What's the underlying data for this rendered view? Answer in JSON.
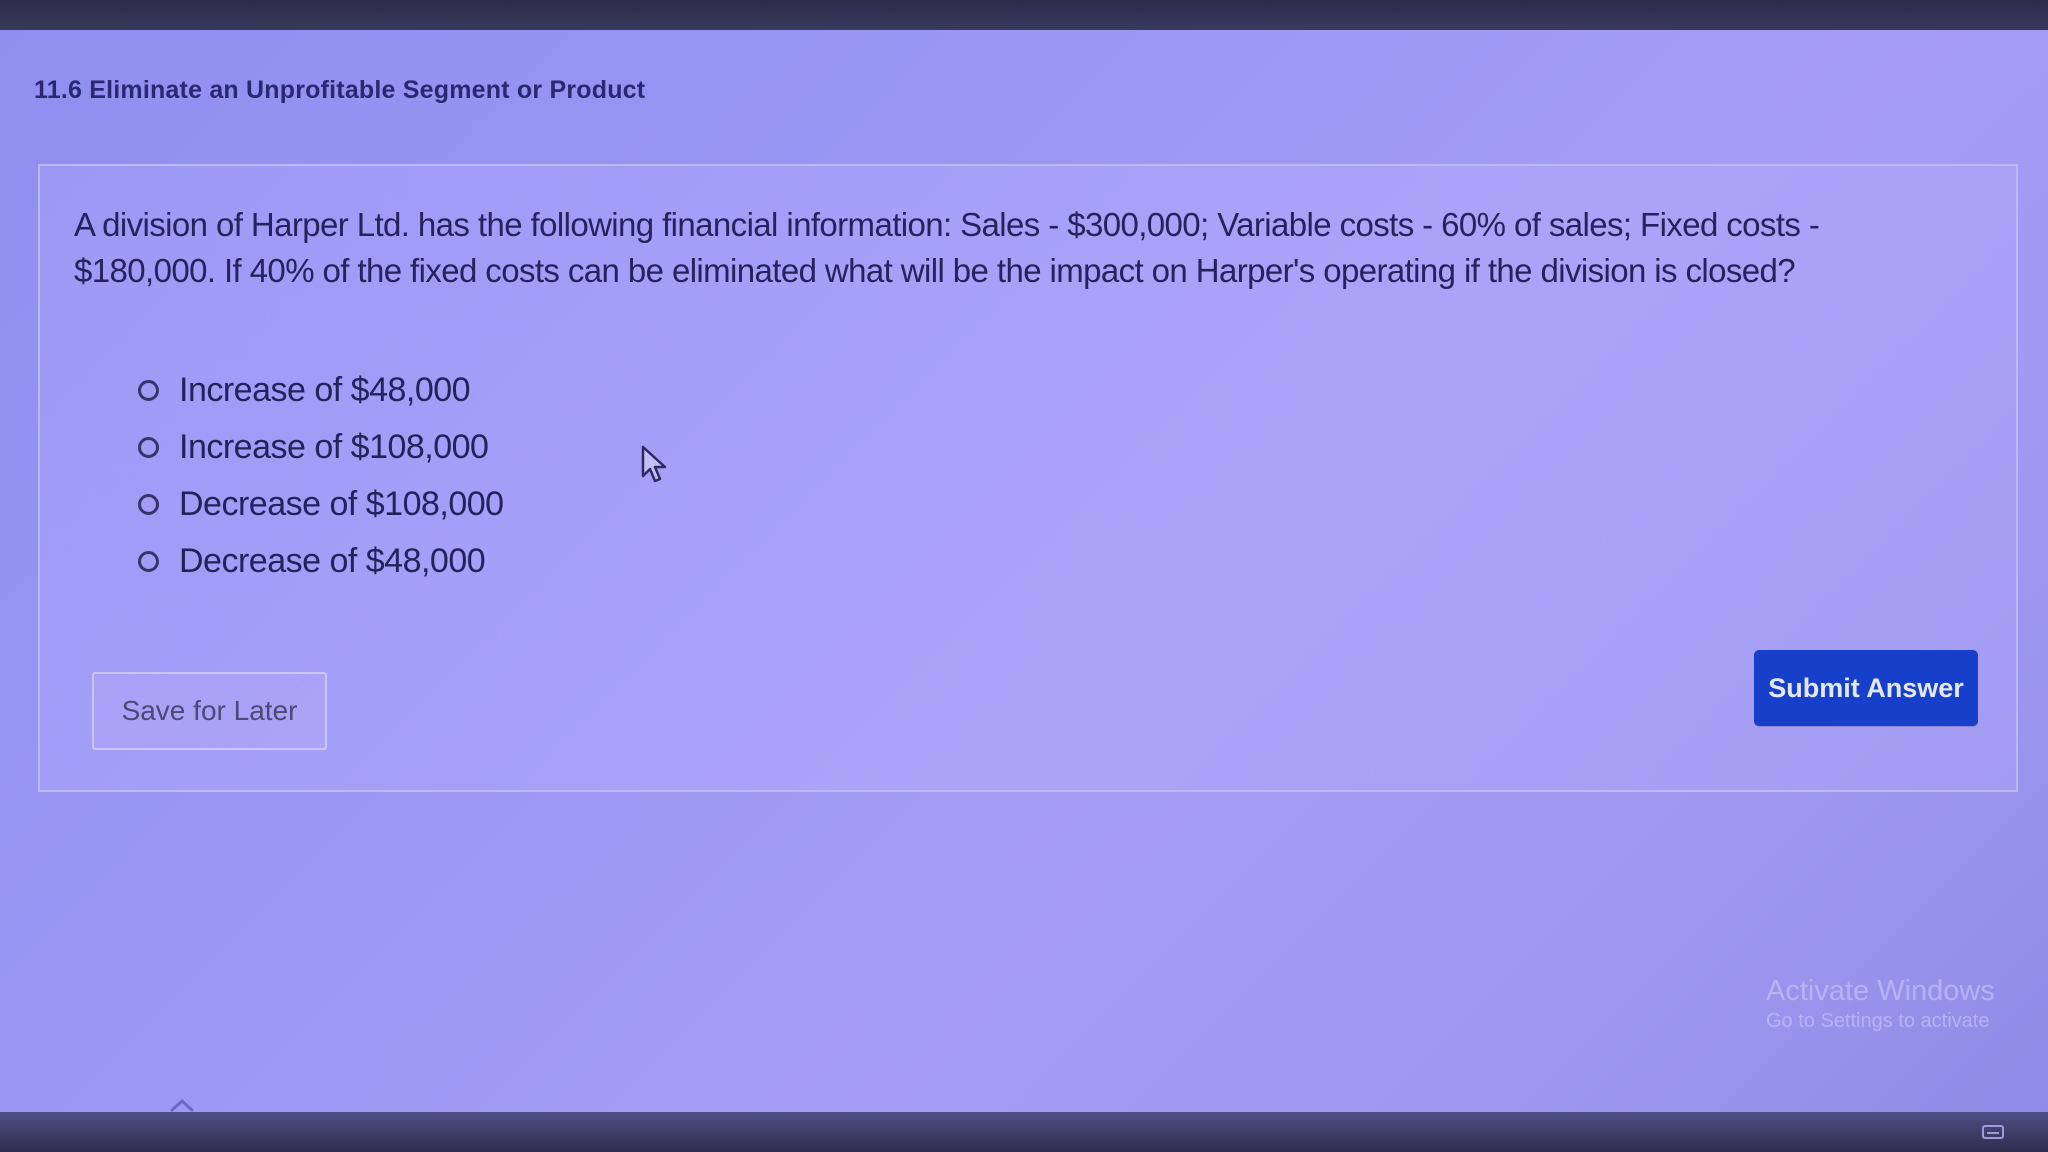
{
  "header": {
    "section_title": "11.6 Eliminate an Unprofitable Segment or Product"
  },
  "question": {
    "text": "A division of Harper Ltd. has the following financial information: Sales - $300,000; Variable costs - 60% of sales; Fixed costs - $180,000. If 40% of the fixed costs can be eliminated what will be the impact on Harper's operating if the division is closed?",
    "options": [
      {
        "label": "Increase of $48,000"
      },
      {
        "label": "Increase of $108,000"
      },
      {
        "label": "Decrease of $108,000"
      },
      {
        "label": "Decrease of $48,000"
      }
    ]
  },
  "actions": {
    "save_label": "Save for Later",
    "submit_label": "Submit Answer"
  },
  "watermark": {
    "line1": "Activate Windows",
    "line2": "Go to Settings to activate"
  },
  "colors": {
    "submit_button": "#1640c9",
    "page_background": "#9a97f4",
    "text_primary": "#25235e"
  },
  "icons": {
    "pointer": "mouse-pointer-icon",
    "scroll": "chevron-up-icon",
    "radio": "radio-unselected-icon"
  }
}
